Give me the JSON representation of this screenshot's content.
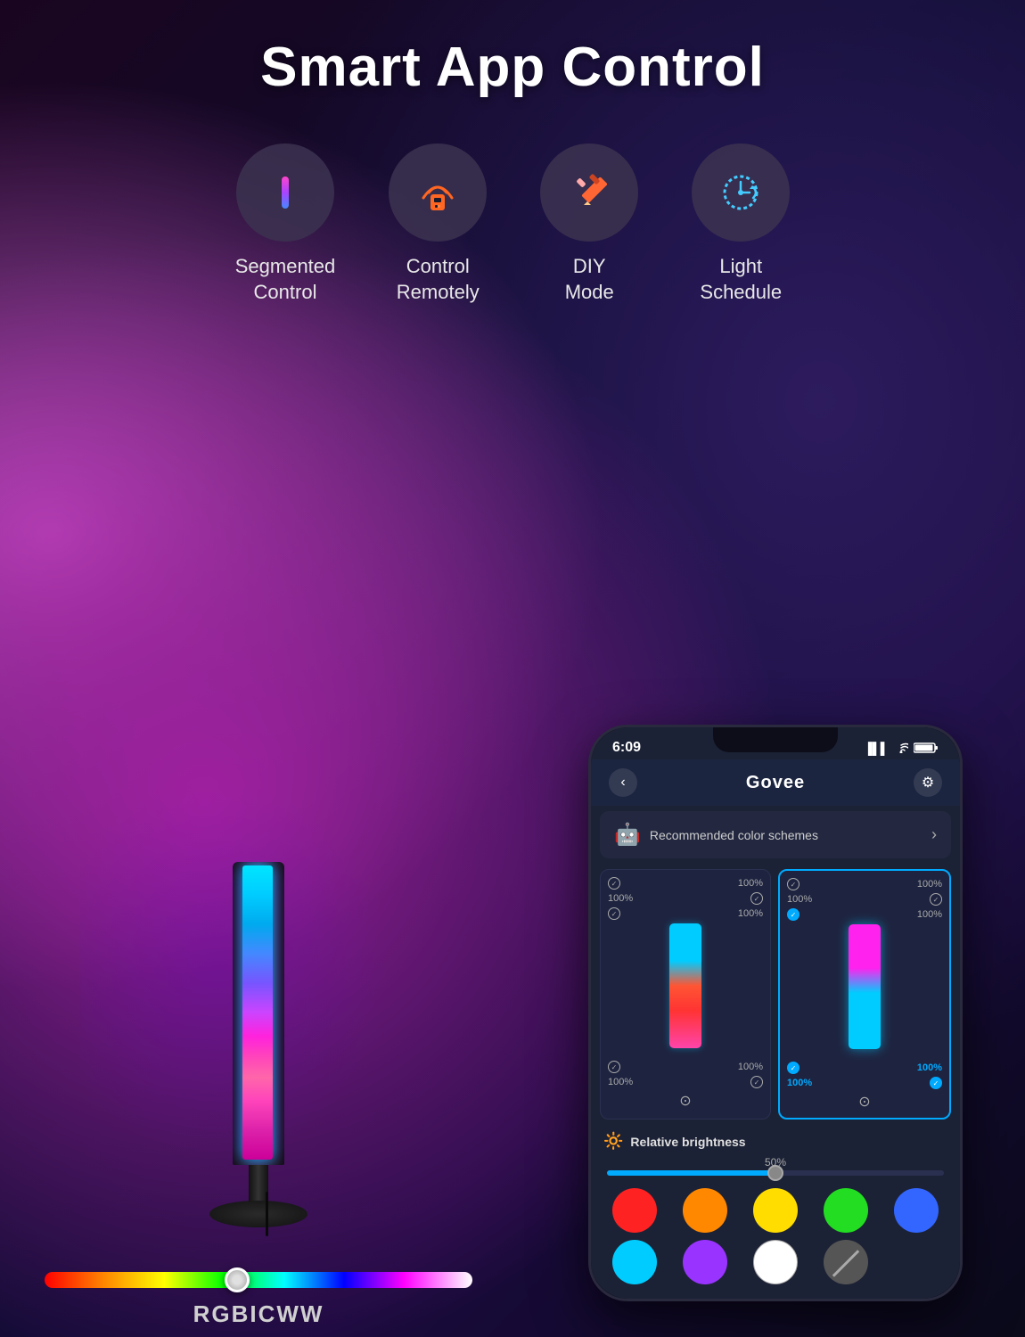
{
  "title": "Smart App Control",
  "features": [
    {
      "id": "segmented-control",
      "label": "Segmented\nControl",
      "icon": "vertical-bar"
    },
    {
      "id": "control-remotely",
      "label": "Control\nRemotely",
      "icon": "remote"
    },
    {
      "id": "diy-mode",
      "label": "DIY\nMode",
      "icon": "pencil"
    },
    {
      "id": "light-schedule",
      "label": "Light\nSchedule",
      "icon": "clock"
    }
  ],
  "lamp": {
    "rgbicww_label": "RGBICWW"
  },
  "phone": {
    "status_time": "6:09",
    "status_signal": "▐▌▌",
    "status_wifi": "WiFi",
    "status_battery": "🔋",
    "header_back": "‹",
    "header_title": "Govee",
    "header_gear": "⚙",
    "recommended_text": "Recommended color schemes",
    "brightness_label": "Relative brightness",
    "brightness_percent": "50%",
    "colors": [
      {
        "class": "swatch-red"
      },
      {
        "class": "swatch-orange"
      },
      {
        "class": "swatch-yellow"
      },
      {
        "class": "swatch-green"
      },
      {
        "class": "swatch-blue"
      },
      {
        "class": "swatch-cyan"
      },
      {
        "class": "swatch-purple"
      },
      {
        "class": "swatch-white"
      },
      {
        "class": "swatch-strikethrough"
      }
    ]
  }
}
